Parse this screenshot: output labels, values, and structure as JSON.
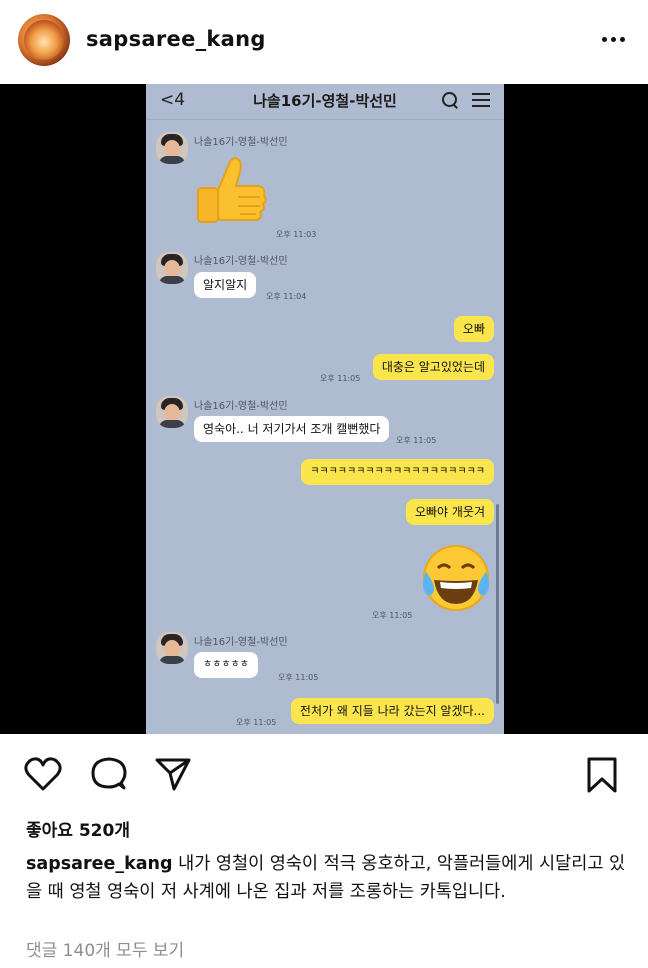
{
  "post": {
    "username": "sapsaree_kang",
    "likes_text": "좋아요 520개",
    "caption": "내가 영철이 영숙이 적극 옹호하고, 악플러들에게 시달리고 있을 때 영철 영숙이 저 사계에 나온 집과 저를 조롱하는 카톡입니다.",
    "comments_link": "댓글 140개 모두 보기"
  },
  "chat": {
    "back_label": "<4",
    "title": "나솔16기-영철-박선민",
    "sender_name": "나솔16기-영철-박선민",
    "messages": [
      {
        "from": "other",
        "type": "emoji",
        "emoji": "thumbs-up",
        "time": "오후 11:03"
      },
      {
        "from": "other",
        "text": "알지알지",
        "time": "오후 11:04"
      },
      {
        "from": "me",
        "text": "오빠"
      },
      {
        "from": "me",
        "text": "대충은 알고있었는데",
        "time": "오후 11:05"
      },
      {
        "from": "other",
        "text": "영숙아.. 너 저기가서 조개 캘뻔했다",
        "time": "오후 11:05"
      },
      {
        "from": "me",
        "text": "ㅋㅋㅋㅋㅋㅋㅋㅋㅋㅋㅋㅋㅋㅋㅋㅋㅋㅋㅋ"
      },
      {
        "from": "me",
        "text": "오빠야 개웃겨"
      },
      {
        "from": "me",
        "type": "emoji",
        "emoji": "tears-of-joy",
        "time": "오후 11:05"
      },
      {
        "from": "other",
        "text": "ㅎㅎㅎㅎㅎ",
        "time": "오후 11:05"
      },
      {
        "from": "me",
        "text": "전처가 왜 지들 나라 갔는지 알겠다...",
        "time": "오후 11:05"
      }
    ]
  },
  "colors": {
    "chat_bg": "#aebbd0",
    "my_bubble": "#fbe54d",
    "other_bubble": "#ffffff",
    "muted_text": "#8e8e8e"
  },
  "icons": [
    "more-icon",
    "heart-icon",
    "comment-icon",
    "share-icon",
    "bookmark-icon",
    "search-icon",
    "menu-icon"
  ]
}
